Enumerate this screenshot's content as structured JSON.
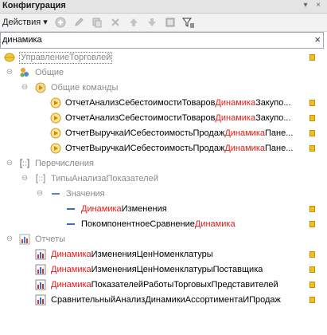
{
  "window": {
    "title": "Конфигурация",
    "close_glyph": "×",
    "menu_glyph": "▾"
  },
  "toolbar": {
    "actions_label": "Действия",
    "actions_caret": "▾"
  },
  "search": {
    "value": "динамика",
    "placeholder": "",
    "clear_glyph": "×"
  },
  "colors": {
    "highlight": "#e01a1a",
    "muted": "#8a8a8a",
    "accent": "#f0c020"
  },
  "tree": {
    "root": {
      "label": "УправлениеТорговлей"
    },
    "common": {
      "label": "Общие"
    },
    "common_commands": {
      "label": "Общие команды"
    },
    "cmd1": {
      "a": "ОтчетАнализСебестоимостиТоваров",
      "b": "Динамика",
      "c": "Закупо..."
    },
    "cmd2": {
      "a": "ОтчетАнализСебестоимостиТоваров",
      "b": "Динамика",
      "c": "Закупо..."
    },
    "cmd3": {
      "a": "ОтчетВыручкаИСебестоимостьПродаж",
      "b": "Динамика",
      "c": "Пане..."
    },
    "cmd4": {
      "a": "ОтчетВыручкаИСебестоимостьПродаж",
      "b": "Динамика",
      "c": "Пане..."
    },
    "enums": {
      "label": "Перечисления"
    },
    "enum_type": {
      "label": "ТипыАнализаПоказателей"
    },
    "values": {
      "label": "Значения"
    },
    "val1": {
      "a": "Динамика",
      "b": "Изменения"
    },
    "val2": {
      "a": "ПокомпонентноеСравнение",
      "b": "Динамика"
    },
    "reports": {
      "label": "Отчеты"
    },
    "rep1": {
      "a": "Динамика",
      "b": "ИзмененияЦенНоменклатуры"
    },
    "rep2": {
      "a": "Динамика",
      "b": "ИзмененияЦенНоменклатурыПоставщика"
    },
    "rep3": {
      "a": "Динамика",
      "b": "ПоказателейРаботыТорговыхПредставителей"
    },
    "rep4": {
      "a": "СравнительныйАнализДинамикиАссортиментаИПродаж"
    }
  }
}
